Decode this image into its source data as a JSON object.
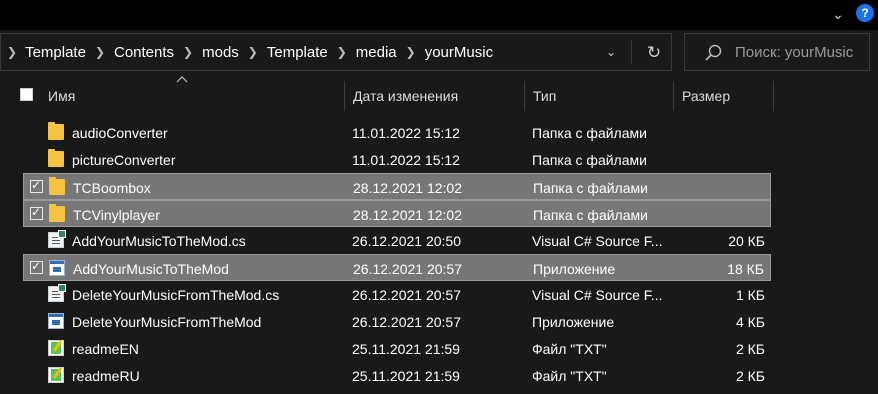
{
  "titlebar": {
    "help_label": "?"
  },
  "address": {
    "crumbs": [
      "Template",
      "Contents",
      "mods",
      "Template",
      "media",
      "yourMusic"
    ]
  },
  "search": {
    "placeholder": "Поиск: yourMusic"
  },
  "columns": {
    "name": "Имя",
    "date": "Дата изменения",
    "type": "Тип",
    "size": "Размер"
  },
  "files": [
    {
      "name": "audioConverter",
      "date": "11.01.2022 15:12",
      "type": "Папка с файлами",
      "size": "",
      "icon": "folder-icon",
      "checked": false,
      "selected": false
    },
    {
      "name": "pictureConverter",
      "date": "11.01.2022 15:12",
      "type": "Папка с файлами",
      "size": "",
      "icon": "folder-icon",
      "checked": false,
      "selected": false
    },
    {
      "name": "TCBoombox",
      "date": "28.12.2021 12:02",
      "type": "Папка с файлами",
      "size": "",
      "icon": "folder-icon",
      "checked": true,
      "selected": true
    },
    {
      "name": "TCVinylplayer",
      "date": "28.12.2021 12:02",
      "type": "Папка с файлами",
      "size": "",
      "icon": "folder-icon",
      "checked": true,
      "selected": true
    },
    {
      "name": "AddYourMusicToTheMod.cs",
      "date": "26.12.2021 20:50",
      "type": "Visual C# Source F...",
      "size": "20 КБ",
      "icon": "csharp-file-icon",
      "checked": false,
      "selected": false
    },
    {
      "name": "AddYourMusicToTheMod",
      "date": "26.12.2021 20:57",
      "type": "Приложение",
      "size": "18 КБ",
      "icon": "application-icon",
      "checked": true,
      "selected": true
    },
    {
      "name": "DeleteYourMusicFromTheMod.cs",
      "date": "26.12.2021 20:57",
      "type": "Visual C# Source F...",
      "size": "1 КБ",
      "icon": "csharp-file-icon",
      "checked": false,
      "selected": false
    },
    {
      "name": "DeleteYourMusicFromTheMod",
      "date": "26.12.2021 20:57",
      "type": "Приложение",
      "size": "4 КБ",
      "icon": "application-icon",
      "checked": false,
      "selected": false
    },
    {
      "name": "readmeEN",
      "date": "25.11.2021 21:59",
      "type": "Файл \"TXT\"",
      "size": "2 КБ",
      "icon": "text-file-icon",
      "checked": false,
      "selected": false
    },
    {
      "name": "readmeRU",
      "date": "25.11.2021 21:59",
      "type": "Файл \"TXT\"",
      "size": "2 КБ",
      "icon": "text-file-icon",
      "checked": false,
      "selected": false
    }
  ]
}
